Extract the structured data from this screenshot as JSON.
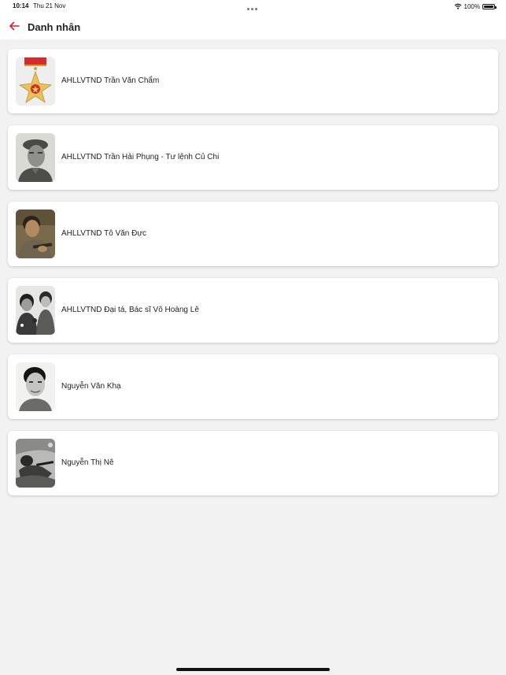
{
  "status": {
    "time": "10:14",
    "date": "Thu 21 Nov",
    "battery": "100%"
  },
  "header": {
    "title": "Danh nhân"
  },
  "items": [
    {
      "label": "AHLLVTND Trần Văn Chẩm"
    },
    {
      "label": "AHLLVTND Trần Hải Phụng - Tư lệnh Củ Chi"
    },
    {
      "label": "AHLLVTND Tô Văn Đực"
    },
    {
      "label": "AHLLVTND Đại tá, Bác sĩ Võ Hoàng Lê"
    },
    {
      "label": "Nguyễn Văn Khạ"
    },
    {
      "label": "Nguyễn Thị Nê"
    }
  ],
  "colors": {
    "accent": "#c0273a",
    "background": "#f2f2f2"
  }
}
